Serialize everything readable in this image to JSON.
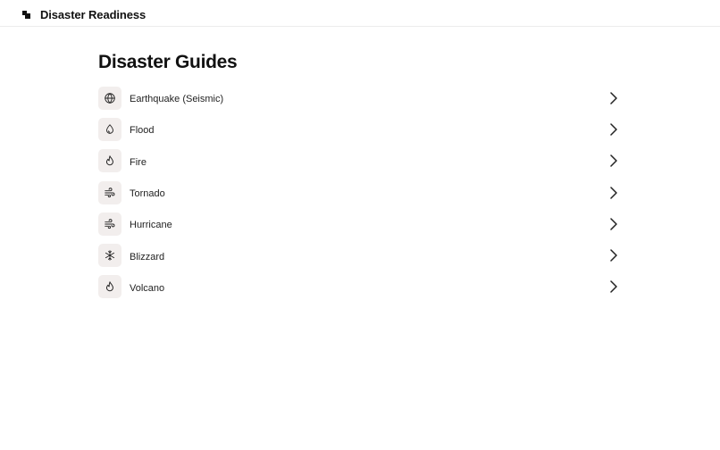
{
  "header": {
    "title": "Disaster Readiness"
  },
  "main": {
    "title": "Disaster Guides",
    "items": [
      {
        "label": "Earthquake (Seismic)",
        "icon": "globe-icon"
      },
      {
        "label": "Flood",
        "icon": "droplet-icon"
      },
      {
        "label": "Fire",
        "icon": "flame-icon"
      },
      {
        "label": "Tornado",
        "icon": "wind-icon"
      },
      {
        "label": "Hurricane",
        "icon": "wind-icon"
      },
      {
        "label": "Blizzard",
        "icon": "snowflake-icon"
      },
      {
        "label": "Volcano",
        "icon": "flame-icon"
      }
    ]
  }
}
